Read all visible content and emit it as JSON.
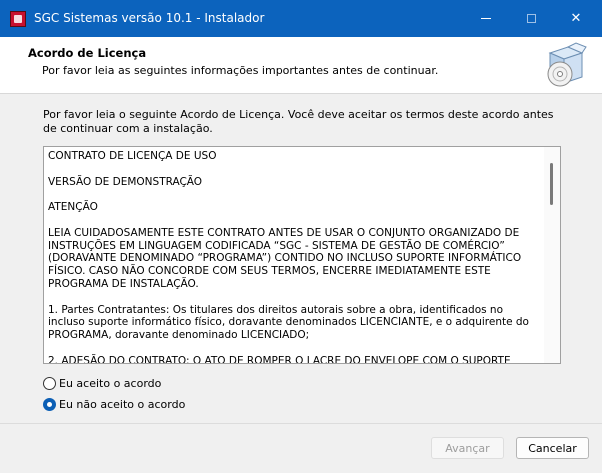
{
  "window": {
    "title": "SGC Sistemas versão 10.1 - Instalador",
    "minimize": "—",
    "maximize": "☐",
    "close": "✕"
  },
  "header": {
    "title": "Acordo de Licença",
    "subtitle": "Por favor leia as seguintes informações importantes antes de continuar."
  },
  "content": {
    "intro": "Por favor leia o seguinte Acordo de Licença. Você deve aceitar os termos deste acordo antes de continuar com a instalação.",
    "license_text": "CONTRATO DE LICENÇA DE USO\n\nVERSÃO DE DEMONSTRAÇÃO\n\nATENÇÃO\n\nLEIA CUIDADOSAMENTE ESTE CONTRATO ANTES DE USAR O CONJUNTO ORGANIZADO DE INSTRUÇÕES EM LINGUAGEM CODIFICADA “SGC - SISTEMA DE GESTÃO DE COMÉRCIO” (DORAVANTE DENOMINADO “PROGRAMA”) CONTIDO NO INCLUSO SUPORTE INFORMÁTICO FÍSICO. CASO NÃO CONCORDE COM SEUS TERMOS, ENCERRE IMEDIATAMENTE ESTE PROGRAMA DE INSTALAÇÃO.\n\n1. Partes Contratantes: Os titulares dos direitos autorais sobre a obra, identificados no incluso suporte informático físico, doravante denominados LICENCIANTE, e o adquirente do PROGRAMA, doravante denominado LICENCIADO;\n\n2. ADESÃO DO CONTRATO: O ATO DE ROMPER O LACRE DO ENVELOPE COM O SUPORTE",
    "options": [
      {
        "label": "Eu aceito o acordo",
        "checked": false
      },
      {
        "label": "Eu não aceito o acordo",
        "checked": true
      }
    ]
  },
  "footer": {
    "next_label": "Avançar",
    "cancel_label": "Cancelar"
  },
  "colors": {
    "titlebar": "#0c63bd",
    "accent": "#0c5fb5",
    "dialog_bg": "#f0f0f0"
  },
  "icons": {
    "app": "app-icon",
    "header": "install-box-disc-icon"
  }
}
